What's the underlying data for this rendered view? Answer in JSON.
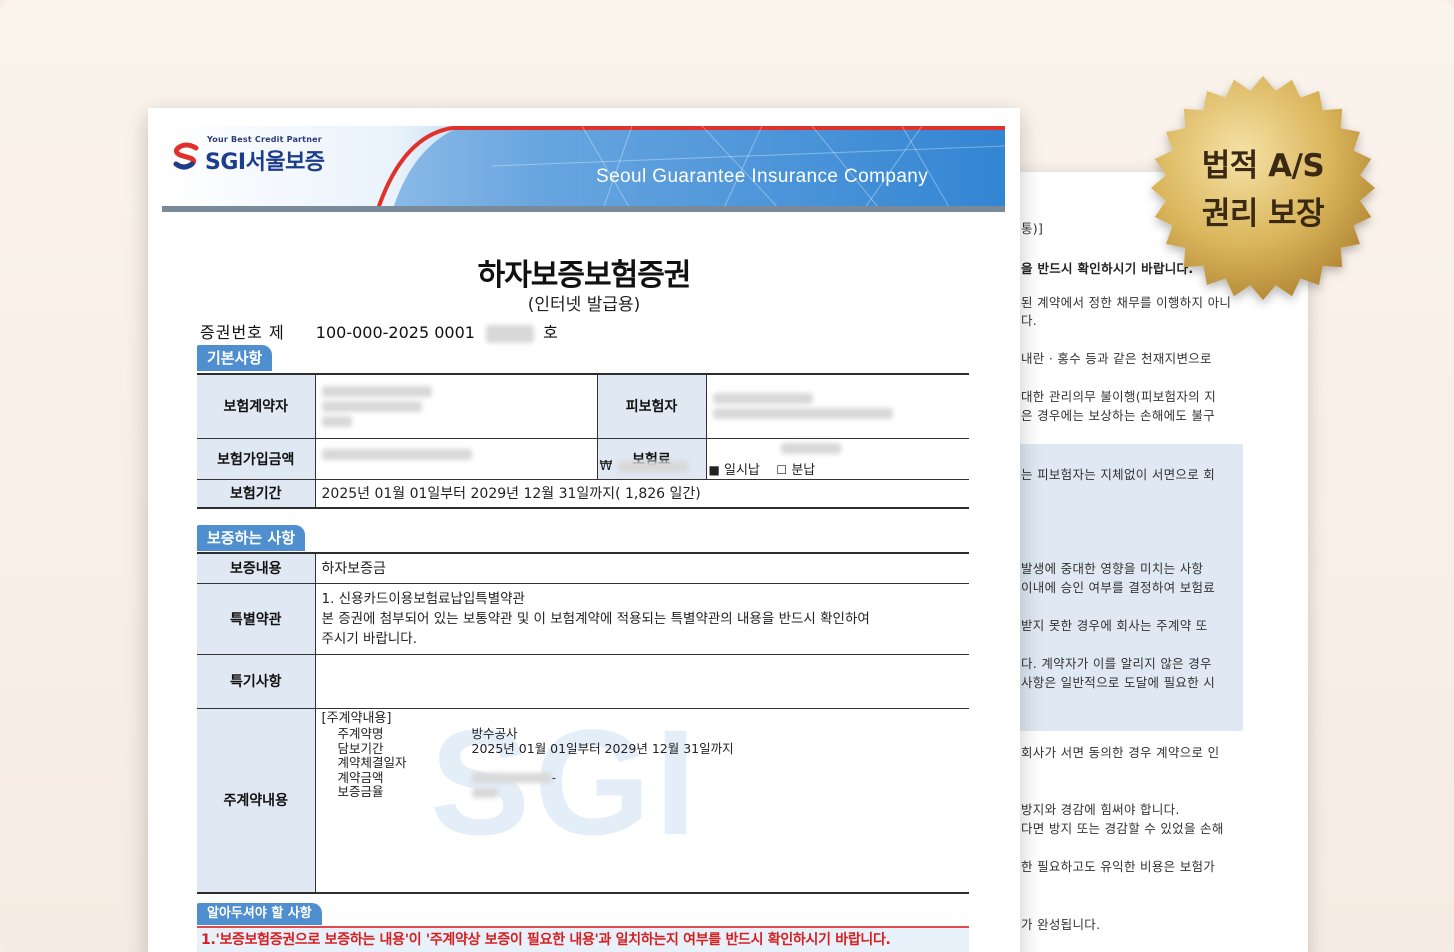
{
  "badge": {
    "line1": "법적 A/S",
    "line2": "권리 보장"
  },
  "back_page": {
    "lines": [
      {
        "text": "통)]",
        "bold": false
      },
      {
        "text": "을 반드시 확인하시기 바랍니다.",
        "bold": true
      },
      {
        "text": "된 계약에서 정한 채무를 이행하지 아니",
        "bold": false
      },
      {
        "text": "다.",
        "bold": false
      },
      {
        "text": "내란 · 홍수 등과 같은 천재지변으로",
        "bold": false
      },
      {
        "text": "대한 관리의무 불이행(피보험자의 지",
        "bold": false
      },
      {
        "text": "은 경우에는 보상하는 손해에도 불구",
        "bold": false
      },
      {
        "text": "는 피보험자는 지체없이 서면으로 회",
        "bold": false
      },
      {
        "text": "발생에 중대한 영향을 미치는 사항",
        "bold": false
      },
      {
        "text": "이내에 승인 여부를 결정하여 보험료",
        "bold": false
      },
      {
        "text": "받지 못한 경우에 회사는 주계약 또",
        "bold": false
      },
      {
        "text": "다. 계약자가 이를 알리지 않은 경우",
        "bold": false
      },
      {
        "text": "사항은 일반적으로 도달에 필요한 시",
        "bold": false
      },
      {
        "text": "회사가 서면 동의한 경우 계약으로 인",
        "bold": false
      },
      {
        "text": "방지와 경감에 힘써야 합니다.",
        "bold": false
      },
      {
        "text": "다면 방지 또는 경감할 수 있었을 손해",
        "bold": false
      },
      {
        "text": "한 필요하고도 유익한 비용은 보험가",
        "bold": false
      },
      {
        "text": "가 완성됩니다.",
        "bold": false
      }
    ]
  },
  "banner": {
    "tagline": "Your Best Credit Partner",
    "logo": "SGI서울보증",
    "english": "Seoul Guarantee Insurance Company"
  },
  "document": {
    "title": "하자보증보험증권",
    "subtitle": "(인터넷 발급용)",
    "cert_label": "증권번호  제",
    "cert_number": "100-000-2025 0001",
    "cert_suffix": "호"
  },
  "basic": {
    "tag": "기본사항",
    "policyholder_label": "보험계약자",
    "insured_label": "피보험자",
    "amount_label": "보험가입금액",
    "currency": "₩",
    "premium_label": "보험료",
    "lump_sum": "일시납",
    "installment": "분납",
    "lump_mark": "■",
    "inst_mark": "☐",
    "period_label": "보험기간",
    "period_value": "2025년 01월 01일부터  2029년 12월 31일까지( 1,826 일간)"
  },
  "coverage": {
    "tag": "보증하는 사항",
    "content_label": "보증내용",
    "content_value": "하자보증금",
    "special_label": "특별약관",
    "special_line1": "1. 신용카드이용보험료납입특별약관",
    "special_line2": "본 증권에 첨부되어 있는 보통약관 및 이 보험계약에 적용되는 특별약관의 내용을 반드시 확인하여",
    "special_line3": "주시기 바랍니다.",
    "notes_label": "특기사항",
    "main_label": "주계약내용",
    "main_header": "[주계약내용]",
    "fields": [
      {
        "label": "주계약명",
        "value": "방수공사"
      },
      {
        "label": "담보기간",
        "value": "2025년 01월 01일부터 2029년 12월 31일까지"
      },
      {
        "label": "계약체결일자",
        "value": ""
      },
      {
        "label": "계약금액",
        "value": ""
      },
      {
        "label": "보증금율",
        "value": ""
      }
    ],
    "amount_dash": "-",
    "watermark": "SGI"
  },
  "notice": {
    "tag": "알아두셔야 할 사항",
    "text": "1.'보증보험증권으로 보증하는 내용'이 '주계약상 보증이 필요한 내용'과 일치하는지 여부를 반드시 확인하시기 바랍니다."
  },
  "colors": {
    "accent_blue": "#4f8fcf",
    "header_fill": "#dfe8f3",
    "notice_red": "#d62020",
    "badge_gold": "#d9b45a"
  }
}
